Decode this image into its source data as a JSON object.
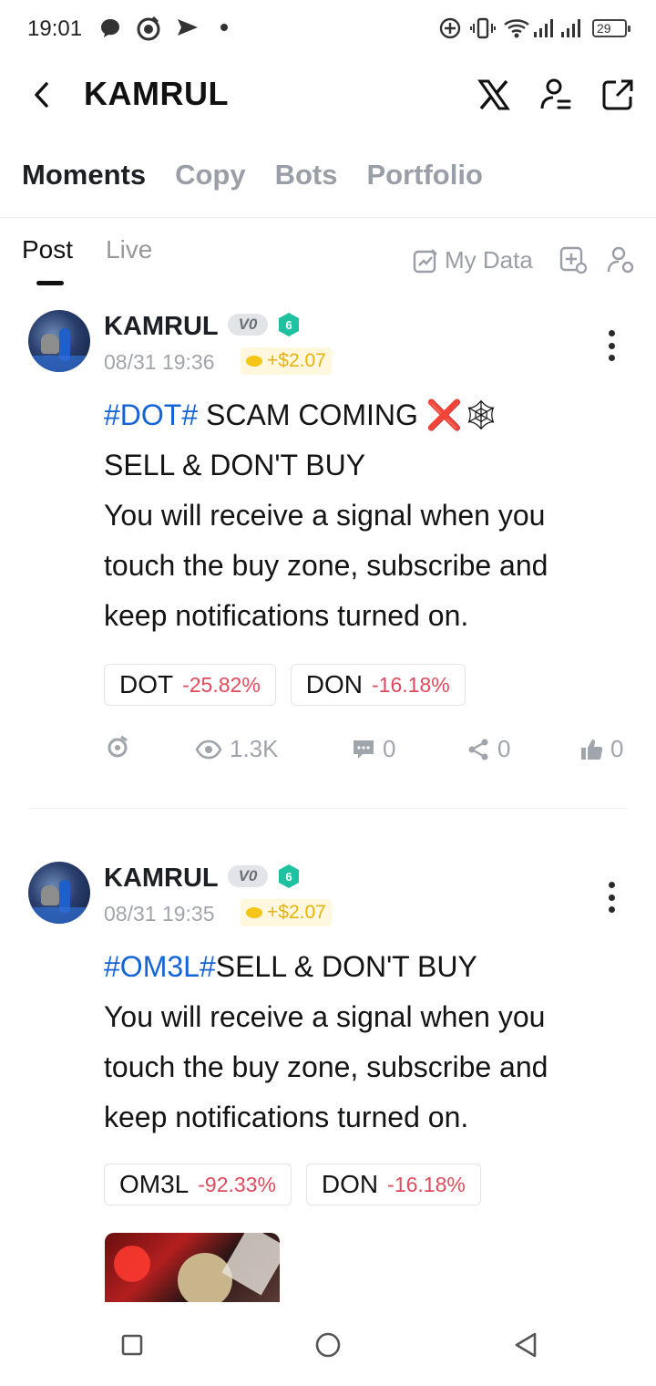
{
  "status_bar": {
    "time": "19:01",
    "battery": "29",
    "icons": [
      "chat-bubble-icon",
      "app-icon",
      "send-icon",
      "add-circle-icon",
      "vibrate-icon",
      "wifi-icon",
      "signal-icon"
    ]
  },
  "header": {
    "title": "KAMRUL",
    "icons": [
      "back-icon",
      "x-logo-icon",
      "profile-settings-icon",
      "share-icon"
    ]
  },
  "main_tabs": [
    {
      "label": "Moments",
      "active": true
    },
    {
      "label": "Copy",
      "active": false
    },
    {
      "label": "Bots",
      "active": false
    },
    {
      "label": "Portfolio",
      "active": false
    }
  ],
  "sub_tabs": {
    "post": "Post",
    "live": "Live",
    "my_data": "My Data",
    "active": "Post"
  },
  "posts": [
    {
      "author": "KAMRUL",
      "vip": "V0",
      "level": "6",
      "date": "08/31 19:36",
      "profit": "+$2.07",
      "tag": "#DOT#",
      "lines": [
        " SCAM COMING ❌🕸",
        "SELL & DON'T BUY",
        "You will receive a signal when you",
        "touch the buy zone, subscribe and",
        "keep notifications turned on."
      ],
      "chips": [
        {
          "symbol": "DOT",
          "change": "-25.82%"
        },
        {
          "symbol": "DON",
          "change": "-16.18%"
        }
      ],
      "stats": {
        "views": "1.3K",
        "comments": "0",
        "shares": "0",
        "likes": "0"
      }
    },
    {
      "author": "KAMRUL",
      "vip": "V0",
      "level": "6",
      "date": "08/31 19:35",
      "profit": "+$2.07",
      "tag": "#OM3L#",
      "lines": [
        "SELL & DON'T BUY",
        "You will receive a signal when you",
        "touch the buy zone, subscribe and",
        "keep notifications turned on."
      ],
      "chips": [
        {
          "symbol": "OM3L",
          "change": "-92.33%"
        },
        {
          "symbol": "DON",
          "change": "-16.18%"
        }
      ]
    }
  ],
  "nav_bar": [
    "recent-apps-icon",
    "home-icon",
    "back-icon"
  ],
  "colors": {
    "hashtag": "#1464d8",
    "negative": "#e04a5a",
    "profit": "#e7b20b",
    "muted": "#a0a4ab"
  }
}
